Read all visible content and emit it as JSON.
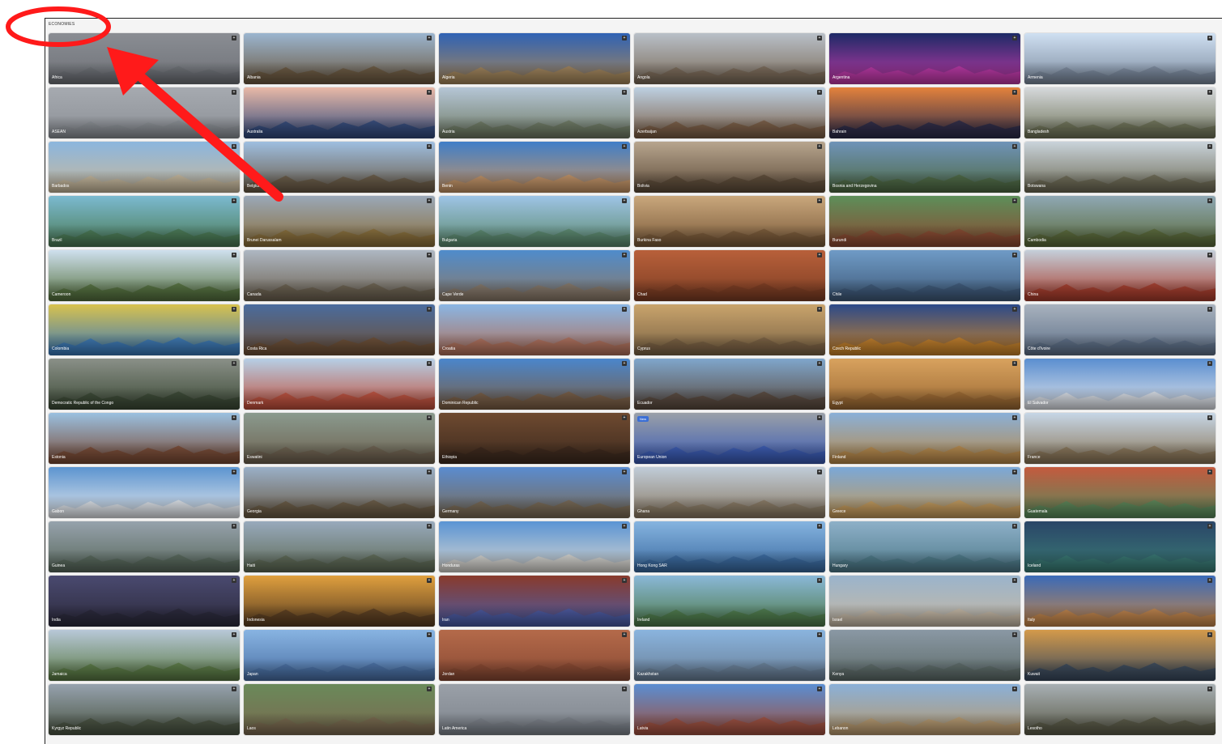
{
  "section_title": "ECONOMIES",
  "tiles": [
    {
      "label": "Africa",
      "sky": "#8a8d93",
      "ground": "#6f7278"
    },
    {
      "label": "Albania",
      "sky": "#9bb5cf",
      "ground": "#6b5840"
    },
    {
      "label": "Algeria",
      "sky": "#2f62b5",
      "ground": "#a5865a"
    },
    {
      "label": "Angola",
      "sky": "#b9c0c8",
      "ground": "#7a6a58"
    },
    {
      "label": "Argentina",
      "sky": "#1d2a66",
      "ground": "#c03aa8"
    },
    {
      "label": "Armenia",
      "sky": "#cfe0f2",
      "ground": "#7b8a9e"
    },
    {
      "label": "ASEAN",
      "sky": "#a6aab0",
      "ground": "#8c9096"
    },
    {
      "label": "Australia",
      "sky": "#e9b9a7",
      "ground": "#314a7c"
    },
    {
      "label": "Austria",
      "sky": "#b5c6d6",
      "ground": "#6f7a64"
    },
    {
      "label": "Azerbaijan",
      "sky": "#bdd0e2",
      "ground": "#7a5d44"
    },
    {
      "label": "Bahrain",
      "sky": "#e4823c",
      "ground": "#2c2b4a"
    },
    {
      "label": "Bangladesh",
      "sky": "#d6d9dc",
      "ground": "#6e7358"
    },
    {
      "label": "Barbados",
      "sky": "#8bb6de",
      "ground": "#c8b89c"
    },
    {
      "label": "Belgium",
      "sky": "#9ebee0",
      "ground": "#6a5a45"
    },
    {
      "label": "Benin",
      "sky": "#3f7ec8",
      "ground": "#c79566"
    },
    {
      "label": "Bolivia",
      "sky": "#b7a58e",
      "ground": "#5e4c3a"
    },
    {
      "label": "Bosnia and Herzegovina",
      "sky": "#6f93b8",
      "ground": "#4f6a44"
    },
    {
      "label": "Botswana",
      "sky": "#c9d3da",
      "ground": "#6d6a55"
    },
    {
      "label": "Brazil",
      "sky": "#7bbad0",
      "ground": "#4b7a55"
    },
    {
      "label": "Brunei Darussalam",
      "sky": "#9aa8b8",
      "ground": "#8a6e3a"
    },
    {
      "label": "Bulgaria",
      "sky": "#9ec4e6",
      "ground": "#5c8a6e"
    },
    {
      "label": "Burkina Faso",
      "sky": "#c9a77c",
      "ground": "#7a5a3a"
    },
    {
      "label": "Burundi",
      "sky": "#5d8f5a",
      "ground": "#8b4a32"
    },
    {
      "label": "Cambodia",
      "sky": "#8fa8b4",
      "ground": "#5a6a3a"
    },
    {
      "label": "Cameroon",
      "sky": "#cfe0ee",
      "ground": "#55713e"
    },
    {
      "label": "Canada",
      "sky": "#aeb7c2",
      "ground": "#6c6150"
    },
    {
      "label": "Cape Verde",
      "sky": "#4f8ccc",
      "ground": "#8a7a6a"
    },
    {
      "label": "Chad",
      "sky": "#b8603a",
      "ground": "#7e3e24"
    },
    {
      "label": "Chile",
      "sky": "#6f9bc6",
      "ground": "#3f5a7a"
    },
    {
      "label": "China",
      "sky": "#c4cfda",
      "ground": "#a83c2c"
    },
    {
      "label": "Colombia",
      "sky": "#d8c24e",
      "ground": "#3a78b8"
    },
    {
      "label": "Costa Rica",
      "sky": "#4a6c9e",
      "ground": "#6e5036"
    },
    {
      "label": "Croatia",
      "sky": "#8ab6e4",
      "ground": "#b0705a"
    },
    {
      "label": "Cyprus",
      "sky": "#c9a46c",
      "ground": "#7a6244"
    },
    {
      "label": "Czech Republic",
      "sky": "#2c4a8a",
      "ground": "#c7822a"
    },
    {
      "label": "Côte d'Ivoire",
      "sky": "#a8b2be",
      "ground": "#5e7088"
    },
    {
      "label": "Democratic Republic of the Congo",
      "sky": "#8a9088",
      "ground": "#3c4a36"
    },
    {
      "label": "Denmark",
      "sky": "#b6cfe6",
      "ground": "#c0503c"
    },
    {
      "label": "Dominican Republic",
      "sky": "#4a86cc",
      "ground": "#7a5e44"
    },
    {
      "label": "Ecuador",
      "sky": "#7fa6cc",
      "ground": "#5a4a3e"
    },
    {
      "label": "Egypt",
      "sky": "#d8a25e",
      "ground": "#9c6a34"
    },
    {
      "label": "El Salvador",
      "sky": "#5a8ed0",
      "ground": "#e0e4ea"
    },
    {
      "label": "Estonia",
      "sky": "#9ac0e0",
      "ground": "#7a4a34"
    },
    {
      "label": "Eswatini",
      "sky": "#8a9a8e",
      "ground": "#6e6250"
    },
    {
      "label": "Ethiopia",
      "sky": "#6e4a30",
      "ground": "#3e2a1e"
    },
    {
      "label": "European Union",
      "sky": "#9aa0a8",
      "ground": "#3a5ab4",
      "badge": "New"
    },
    {
      "label": "Finland",
      "sky": "#8ab0d8",
      "ground": "#b88a4a"
    },
    {
      "label": "France",
      "sky": "#c6d6e6",
      "ground": "#8a7658"
    },
    {
      "label": "Gabon",
      "sky": "#5c94d0",
      "ground": "#e4e8ec"
    },
    {
      "label": "Georgia",
      "sky": "#9ab0c8",
      "ground": "#6a5a44"
    },
    {
      "label": "Germany",
      "sky": "#5a8cd0",
      "ground": "#7a6a54"
    },
    {
      "label": "Ghana",
      "sky": "#c0ccd8",
      "ground": "#8a7a64"
    },
    {
      "label": "Greece",
      "sky": "#7aa8d8",
      "ground": "#c49a5a"
    },
    {
      "label": "Guatemala",
      "sky": "#c45a3e",
      "ground": "#5a8a5c"
    },
    {
      "label": "Guinea",
      "sky": "#96a2ac",
      "ground": "#58685c"
    },
    {
      "label": "Haiti",
      "sky": "#98aabc",
      "ground": "#5e6a56"
    },
    {
      "label": "Honduras",
      "sky": "#5a94d4",
      "ground": "#d8d6d0"
    },
    {
      "label": "Hong Kong SAR",
      "sky": "#86b4e0",
      "ground": "#3a6aa0"
    },
    {
      "label": "Hungary",
      "sky": "#8eb0c8",
      "ground": "#4e7a8a"
    },
    {
      "label": "Iceland",
      "sky": "#2a4668",
      "ground": "#3a7a74"
    },
    {
      "label": "India",
      "sky": "#4a4a70",
      "ground": "#2c2a3c"
    },
    {
      "label": "Indonesia",
      "sky": "#e0a03e",
      "ground": "#5a3e22"
    },
    {
      "label": "Iran",
      "sky": "#8a3a2c",
      "ground": "#4a5ca4"
    },
    {
      "label": "Ireland",
      "sky": "#8ab8d8",
      "ground": "#4e7a4a"
    },
    {
      "label": "Israel",
      "sky": "#9ab4cc",
      "ground": "#c6b8a4"
    },
    {
      "label": "Italy",
      "sky": "#3a6ab8",
      "ground": "#c4864a"
    },
    {
      "label": "Jamaica",
      "sky": "#b8c8d8",
      "ground": "#5a7a44"
    },
    {
      "label": "Japan",
      "sky": "#88b4e2",
      "ground": "#4a70a4"
    },
    {
      "label": "Jordan",
      "sky": "#b46a4a",
      "ground": "#8a4a34"
    },
    {
      "label": "Kazakhstan",
      "sky": "#8ab4de",
      "ground": "#6a8098"
    },
    {
      "label": "Kenya",
      "sky": "#8a98a4",
      "ground": "#5e6c6a"
    },
    {
      "label": "Kuwait",
      "sky": "#d49a4a",
      "ground": "#3a4a5e"
    },
    {
      "label": "Kyrgyz Republic",
      "sky": "#96a2ae",
      "ground": "#4a5442"
    },
    {
      "label": "Laos",
      "sky": "#6a8a5a",
      "ground": "#7a6a50"
    },
    {
      "label": "Latin America",
      "sky": "#9aa0a8",
      "ground": "#7e848c"
    },
    {
      "label": "Latvia",
      "sky": "#5a8ed2",
      "ground": "#a0503e"
    },
    {
      "label": "Lebanon",
      "sky": "#8ab0d8",
      "ground": "#b89a6e"
    },
    {
      "label": "Lesotho",
      "sky": "#a8b0b4",
      "ground": "#5a5a48"
    }
  ],
  "annotation": {
    "shape": "ellipse",
    "color": "#ff0000",
    "pointer": "arrow"
  }
}
